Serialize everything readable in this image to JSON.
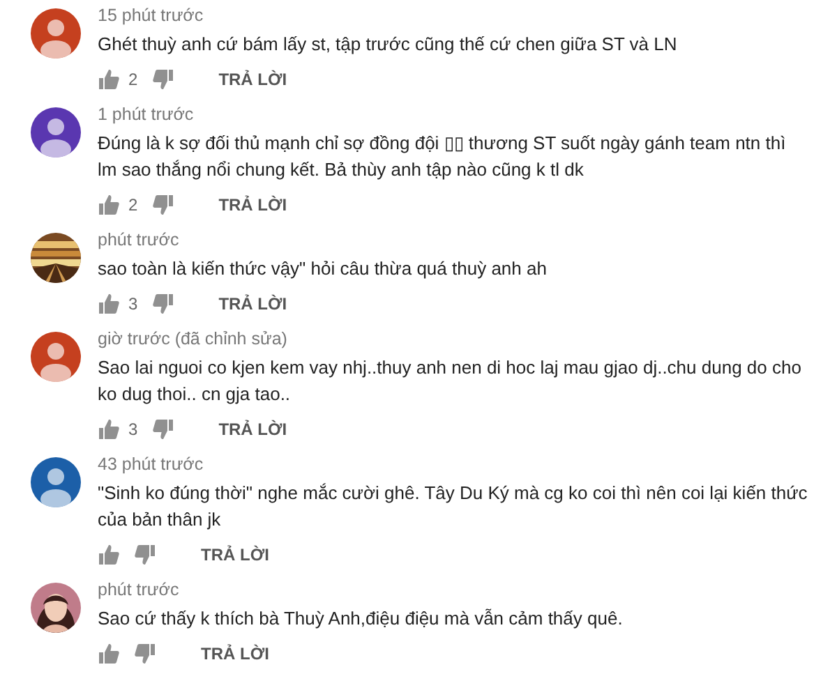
{
  "comments": [
    {
      "time": "15 phút trước",
      "text": "Ghét thuỳ anh cứ bám lấy st, tập trước cũng thế cứ chen giữa ST và LN",
      "likes": "2",
      "avatar": {
        "kind": "default",
        "color": "#c5401f"
      },
      "reply": "TRẢ LỜI"
    },
    {
      "time": "1 phút trước",
      "text": "Đúng là k sợ đối thủ mạnh chỉ sợ đồng đội ▯▯ thương ST suốt ngày gánh team ntn thì lm sao thắng nổi chung kết. Bả thùy anh tập nào cũng k tl dk",
      "likes": "2",
      "avatar": {
        "kind": "default",
        "color": "#5a37b0"
      },
      "reply": "TRẢ LỜI"
    },
    {
      "time": "phút trước",
      "text": "sao toàn là kiến thức vậy\" hỏi câu thừa quá thuỳ anh ah",
      "likes": "3",
      "reply": "TRẢ LỜI"
    },
    {
      "time": "giờ trước (đã chỉnh sửa)",
      "text": "Sao lai nguoi co kjen kem vay nhj..thuy anh nen di hoc laj mau gjao dj..chu dung do cho ko dug thoi.. cn gja tao..",
      "likes": "3",
      "avatar": {
        "kind": "default",
        "color": "#c5401f"
      },
      "reply": "TRẢ LỜI"
    },
    {
      "time": "43 phút trước",
      "text": "\"Sinh ko đúng thời\" nghe mắc cười ghê. Tây Du Ký mà cg ko coi thì nên coi lại kiến thức của bản thân jk",
      "avatar": {
        "kind": "default",
        "color": "#1c5fa8"
      },
      "reply": "TRẢ LỜI"
    },
    {
      "time": "phút trước",
      "text": "Sao cứ thấy k thích bà Thuỳ Anh,điệu điệu mà vẫn cảm thấy quê.",
      "reply": "TRẢ LỜI"
    }
  ]
}
